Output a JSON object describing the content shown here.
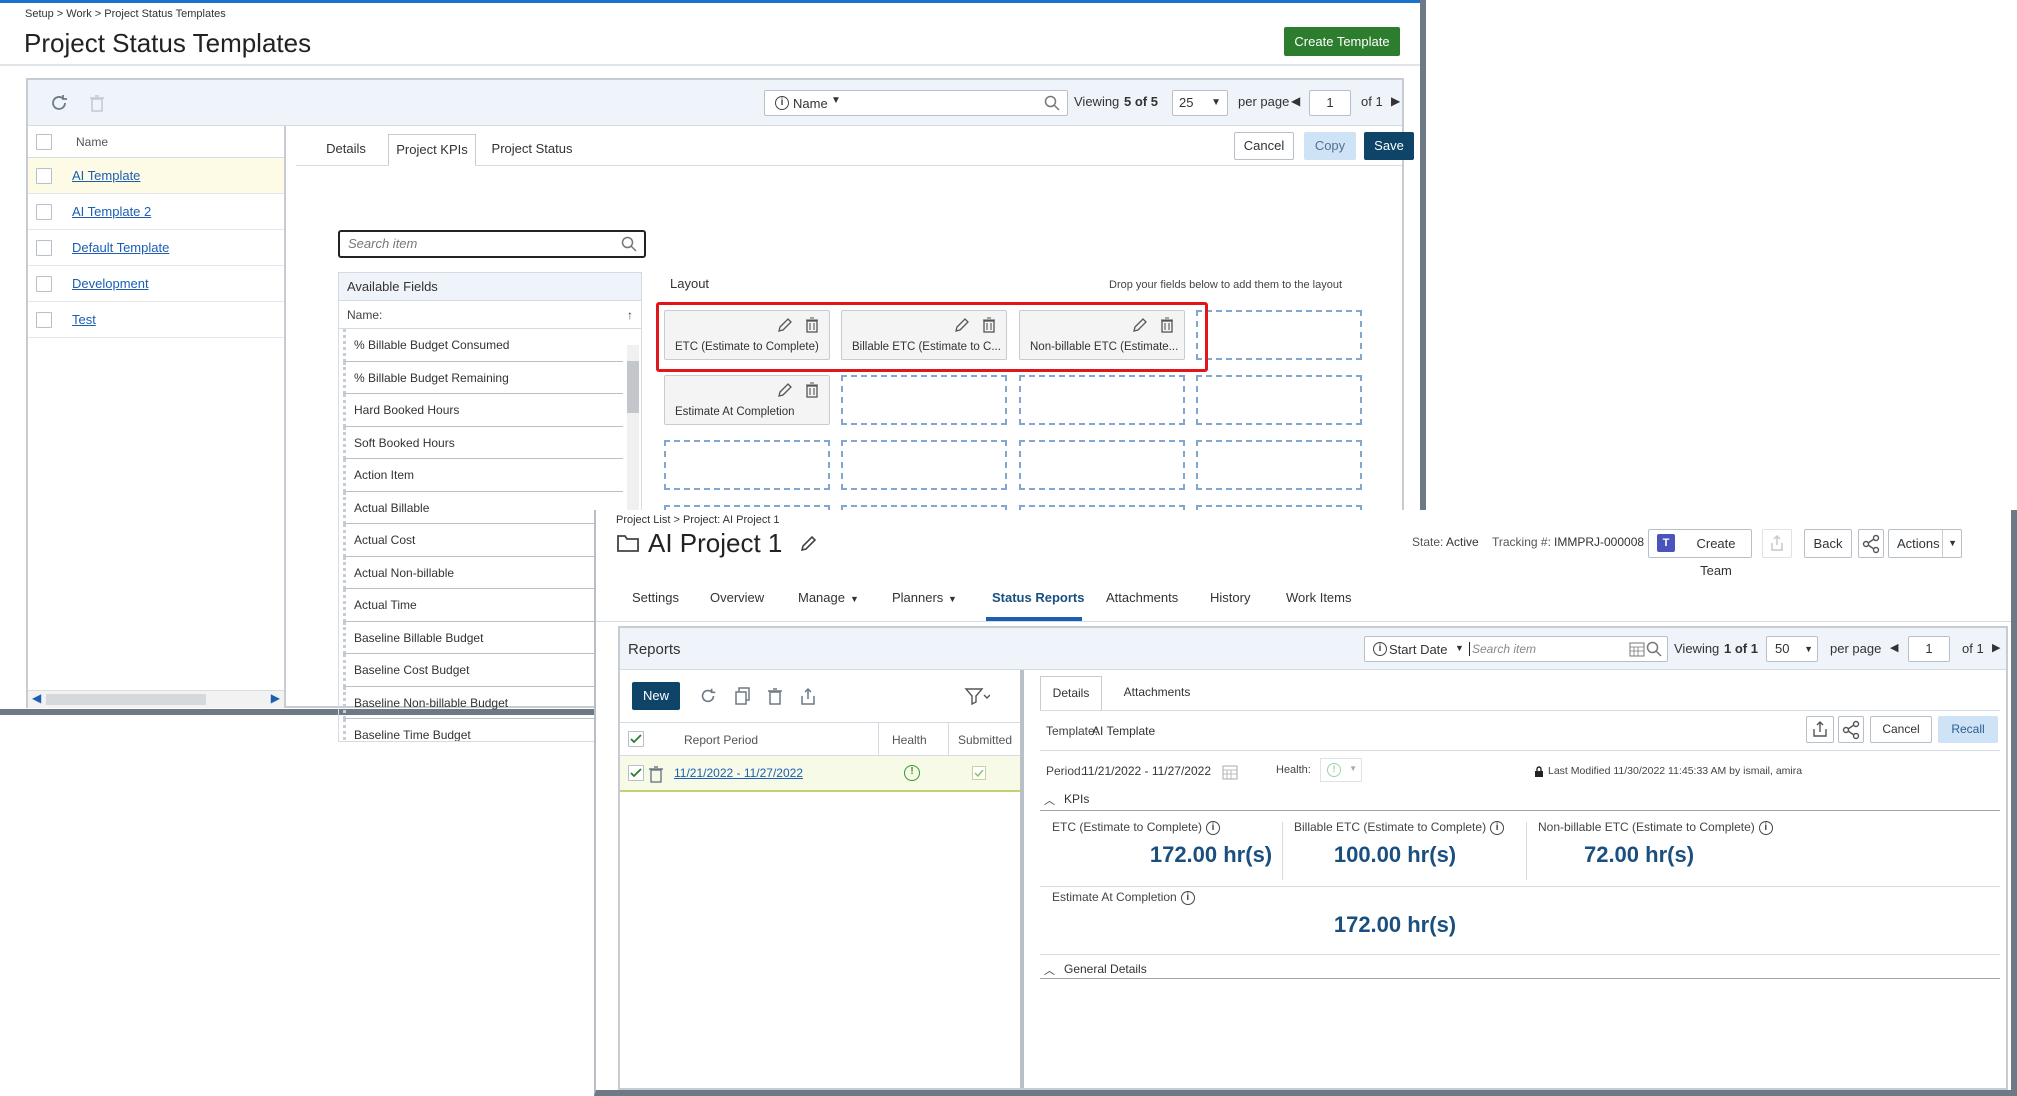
{
  "templates": {
    "breadcrumb": "Setup > Work > Project Status Templates",
    "title": "Project Status Templates",
    "create_button": "Create Template",
    "filter_field": "Name",
    "viewing_label": "Viewing",
    "viewing_count": "5 of 5",
    "per_page_value": "25",
    "per_page_label": "per page",
    "page_input": "1",
    "page_of": "of 1",
    "list_header": "Name",
    "list": [
      "AI Template",
      "AI Template 2",
      "Default Template",
      "Development",
      "Test"
    ],
    "tabs": [
      "Details",
      "Project KPIs",
      "Project Status"
    ],
    "cancel": "Cancel",
    "copy": "Copy",
    "save": "Save",
    "search_placeholder": "Search item",
    "available_fields_title": "Available Fields",
    "available_fields_sub": "Name:",
    "available_fields": [
      "% Billable Budget Consumed",
      "% Billable Budget Remaining",
      "Hard Booked Hours",
      "Soft Booked Hours",
      "Action Item",
      "Actual Billable",
      "Actual Cost",
      "Actual Non-billable",
      "Actual Time",
      "Baseline Billable Budget",
      "Baseline Cost Budget",
      "Baseline Non-billable Budget",
      "Baseline Time Budget"
    ],
    "layout_label": "Layout",
    "layout_hint": "Drop your fields below to add them to the layout",
    "layout_cells": [
      "ETC (Estimate to Complete)",
      "Billable ETC (Estimate to C...",
      "Non-billable ETC (Estimate...",
      "Estimate At Completion"
    ]
  },
  "project": {
    "breadcrumb": "Project List > Project: AI Project 1",
    "title": "AI Project 1",
    "state_label": "State:",
    "state_value": "Active",
    "tracking_label": "Tracking #:",
    "tracking_value": "IMMPRJ-000008",
    "create_team": "Create Team",
    "back": "Back",
    "actions": "Actions",
    "nav": [
      "Settings",
      "Overview",
      "Manage",
      "Planners",
      "Status Reports",
      "Attachments",
      "History",
      "Work Items"
    ],
    "reports_title": "Reports",
    "filter_field": "Start Date",
    "search_placeholder": "Search item",
    "viewing_label": "Viewing",
    "viewing_count": "1 of 1",
    "per_page_value": "50",
    "per_page_label": "per page",
    "page_input": "1",
    "page_of": "of 1",
    "new_button": "New",
    "col_period": "Report Period",
    "col_health": "Health",
    "col_submitted": "Submitted",
    "row_period": "11/21/2022 - 11/27/2022",
    "detail_tabs": [
      "Details",
      "Attachments"
    ],
    "template_label": "Template:",
    "template_value": "AI Template",
    "cancel": "Cancel",
    "recall": "Recall",
    "period_label": "Period:",
    "period_value": "11/21/2022 - 11/27/2022",
    "health_label": "Health:",
    "last_modified": "Last Modified 11/30/2022 11:45:33 AM by ismail, amira",
    "kpis_section": "KPIs",
    "kpis": [
      {
        "label": "ETC (Estimate to Complete)",
        "value": "172.00 hr(s)"
      },
      {
        "label": "Billable ETC (Estimate to Complete)",
        "value": "100.00 hr(s)"
      },
      {
        "label": "Non-billable ETC (Estimate to Complete)",
        "value": "72.00 hr(s)"
      },
      {
        "label": "Estimate At Completion",
        "value": "172.00 hr(s)"
      }
    ],
    "general_section": "General Details"
  },
  "colors": {
    "accent": "#1a5fb4",
    "green": "#2d7d2f",
    "navy": "#0d4468",
    "highlight": "#e0161b"
  }
}
